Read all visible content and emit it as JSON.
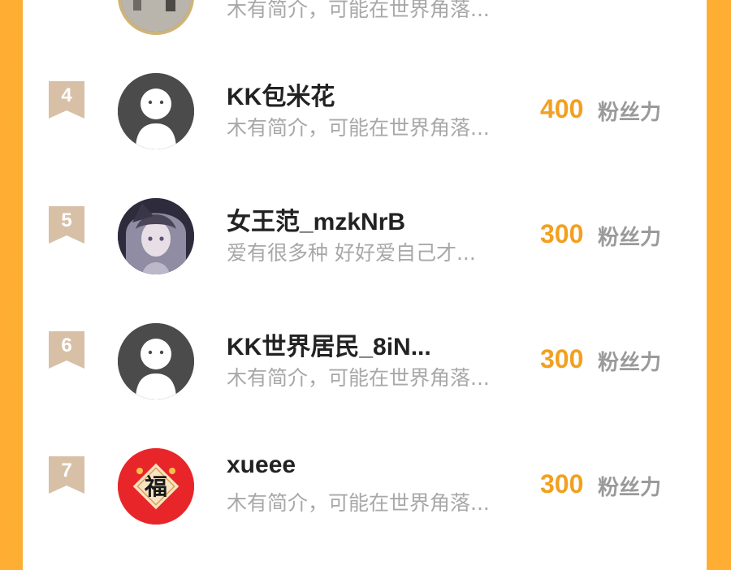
{
  "leaderboard": {
    "partial_top_entry": {
      "bio": "木有简介，可能在世界角落..."
    },
    "entries": [
      {
        "rank": "4",
        "name": "KK包米花",
        "bio": "木有简介，可能在世界角落...",
        "score": "400",
        "score_unit": "粉丝力",
        "avatar": "default-person-avatar"
      },
      {
        "rank": "5",
        "name": "女王范_mzkNrB",
        "bio": "爱有很多种 好好爱自己才...",
        "score": "300",
        "score_unit": "粉丝力",
        "avatar": "anime-girl-avatar"
      },
      {
        "rank": "6",
        "name": "KK世界居民_8iN...",
        "bio": "木有简介，可能在世界角落...",
        "score": "300",
        "score_unit": "粉丝力",
        "avatar": "default-person-avatar"
      },
      {
        "rank": "7",
        "name": "xueee",
        "bio": "木有简介，可能在世界角落...",
        "score": "300",
        "score_unit": "粉丝力",
        "avatar": "fu-character-avatar",
        "avatar_text": "福"
      }
    ]
  },
  "colors": {
    "background_orange": "#ffad33",
    "score_gold": "#f2a020",
    "rank_badge_tan": "#d7c0a6",
    "name_text": "#222222",
    "bio_text": "#a8a8a8",
    "fu_red": "#e8262a"
  }
}
